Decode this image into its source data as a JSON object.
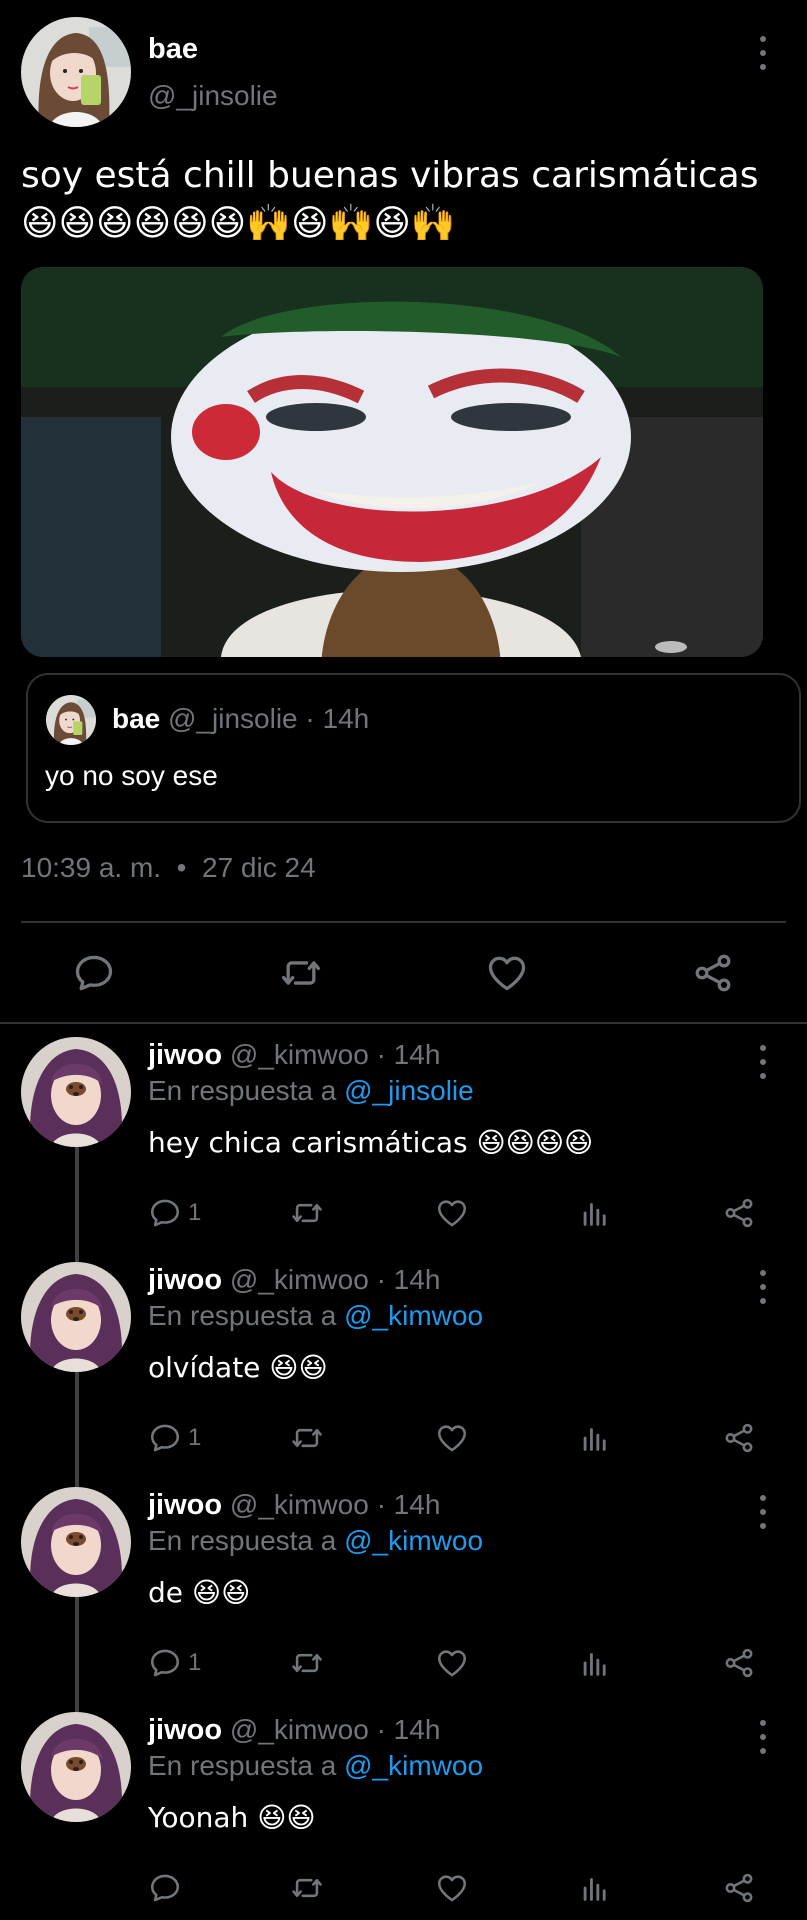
{
  "main": {
    "name": "bae",
    "handle": "@_jinsolie",
    "text": "soy está chill buenas vibras carismáticas 😆😆😆😆😆😆🙌😆🙌😆🙌",
    "quote": {
      "name": "bae",
      "meta": "@_jinsolie · 14h",
      "text": "yo no soy ese"
    },
    "timestamp": "10:39 a. m.  •  27 dic 24"
  },
  "replies": [
    {
      "name": "jiwoo",
      "meta": "@_kimwoo · 14h",
      "reply_prefix": "En respuesta a ",
      "reply_to": "@_jinsolie",
      "text": "hey chica carismáticas 😆😆😆😆",
      "reply_count": "1"
    },
    {
      "name": "jiwoo",
      "meta": "@_kimwoo · 14h",
      "reply_prefix": "En respuesta a ",
      "reply_to": "@_kimwoo",
      "text": "olvídate 😆😆",
      "reply_count": "1"
    },
    {
      "name": "jiwoo",
      "meta": "@_kimwoo · 14h",
      "reply_prefix": "En respuesta a ",
      "reply_to": "@_kimwoo",
      "text": "de 😆😆",
      "reply_count": "1"
    },
    {
      "name": "jiwoo",
      "meta": "@_kimwoo · 14h",
      "reply_prefix": "En respuesta a ",
      "reply_to": "@_kimwoo",
      "text": "Yoonah 😆😆",
      "reply_count": ""
    }
  ],
  "icons": {
    "reply": "reply-icon",
    "retweet": "retweet-icon",
    "like": "heart-icon",
    "share": "share-icon",
    "views": "views-icon",
    "more": "more-icon"
  },
  "colors": {
    "background": "#000000",
    "text": "#e7e9ea",
    "muted": "#71767b",
    "link": "#1d9bf0",
    "border": "#2f3336"
  }
}
